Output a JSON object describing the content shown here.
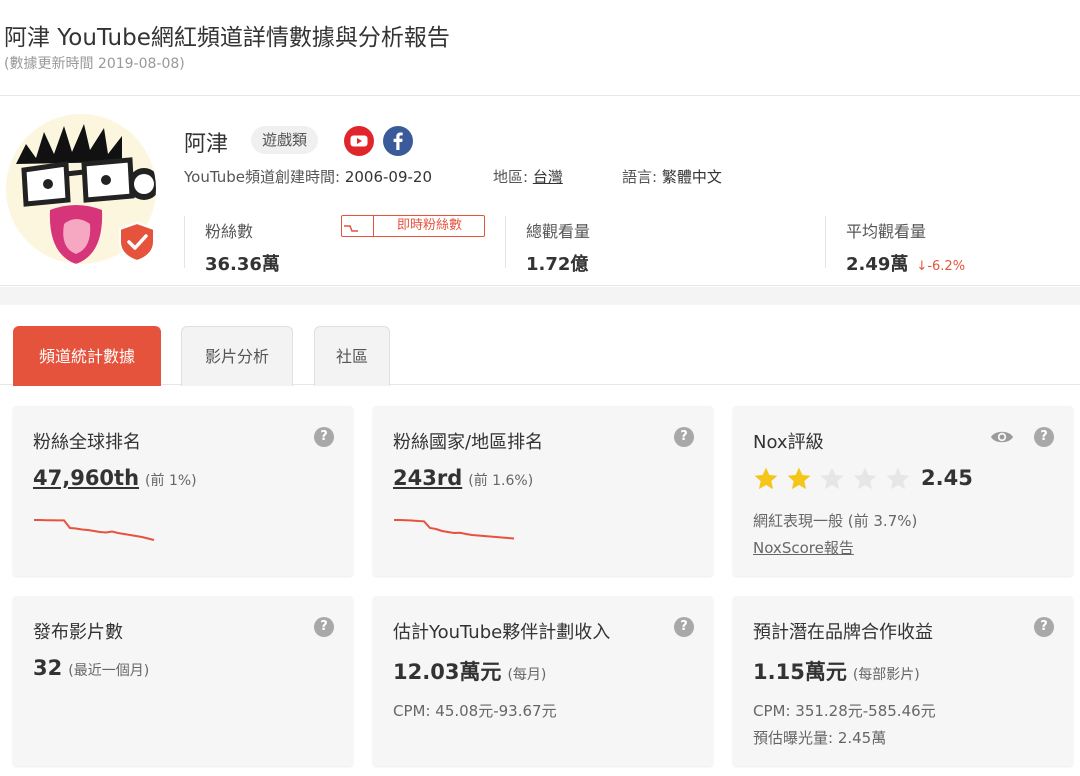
{
  "page": {
    "title": "阿津 YouTube網紅頻道詳情數據與分析報告",
    "update_time": "(數據更新時間 2019-08-08)"
  },
  "profile": {
    "name": "阿津",
    "category": "遊戲類",
    "created_label": "YouTube頻道創建時間: ",
    "created_value": "2006-09-20",
    "region_label": "地區: ",
    "region_value": "台灣",
    "language_label": "語言: ",
    "language_value": "繁體中文",
    "stats": {
      "subscribers_label": "粉絲數",
      "subscribers_value": "36.36萬",
      "realtime_button": "即時粉絲數",
      "views_label": "總觀看量",
      "views_value": "1.72億",
      "avg_views_label": "平均觀看量",
      "avg_views_value": "2.49萬",
      "avg_views_change": "-6.2%"
    }
  },
  "tabs": [
    {
      "label": "頻道統計數據",
      "active": true
    },
    {
      "label": "影片分析",
      "active": false
    },
    {
      "label": "社區",
      "active": false
    }
  ],
  "cards": {
    "global_rank": {
      "title": "粉絲全球排名",
      "value": "47,960th",
      "sub": "(前 1%)",
      "trend": [
        10,
        10,
        10.2,
        10.3,
        10.4,
        10.4,
        18,
        18.5,
        19.5,
        20,
        21,
        22,
        22.5,
        21.5,
        23,
        24,
        25,
        26,
        27,
        28.5,
        30
      ]
    },
    "country_rank": {
      "title": "粉絲國家/地區排名",
      "value": "243rd",
      "sub": "(前 1.6%)",
      "trend": [
        10,
        10,
        10.2,
        10.5,
        11,
        11.3,
        18,
        19,
        21,
        22,
        23,
        22.8,
        24,
        25,
        25.5,
        26,
        26.5,
        27,
        27.5,
        28,
        28.5
      ]
    },
    "nox": {
      "title": "Nox評級",
      "score": "2.45",
      "stars": 2,
      "stars_max": 5,
      "desc": "網紅表現一般 (前 3.7%)",
      "link": "NoxScore報告"
    },
    "videos": {
      "title": "發布影片數",
      "value": "32",
      "sub": "(最近一個月)"
    },
    "revenue": {
      "title": "估計YouTube夥伴計劃收入",
      "value": "12.03萬元",
      "sub": "(每月)",
      "cpm": "CPM: 45.08元-93.67元"
    },
    "brand": {
      "title": "預計潛在品牌合作收益",
      "value": "1.15萬元",
      "sub": "(每部影片)",
      "cpm": "CPM: 351.28元-585.46元",
      "exposure": "預估曝光量: 2.45萬"
    }
  },
  "colors": {
    "accent": "#e5533d",
    "star_on": "#f5c518",
    "star_off": "#e6e6e6"
  },
  "icons": {
    "help": "?"
  }
}
